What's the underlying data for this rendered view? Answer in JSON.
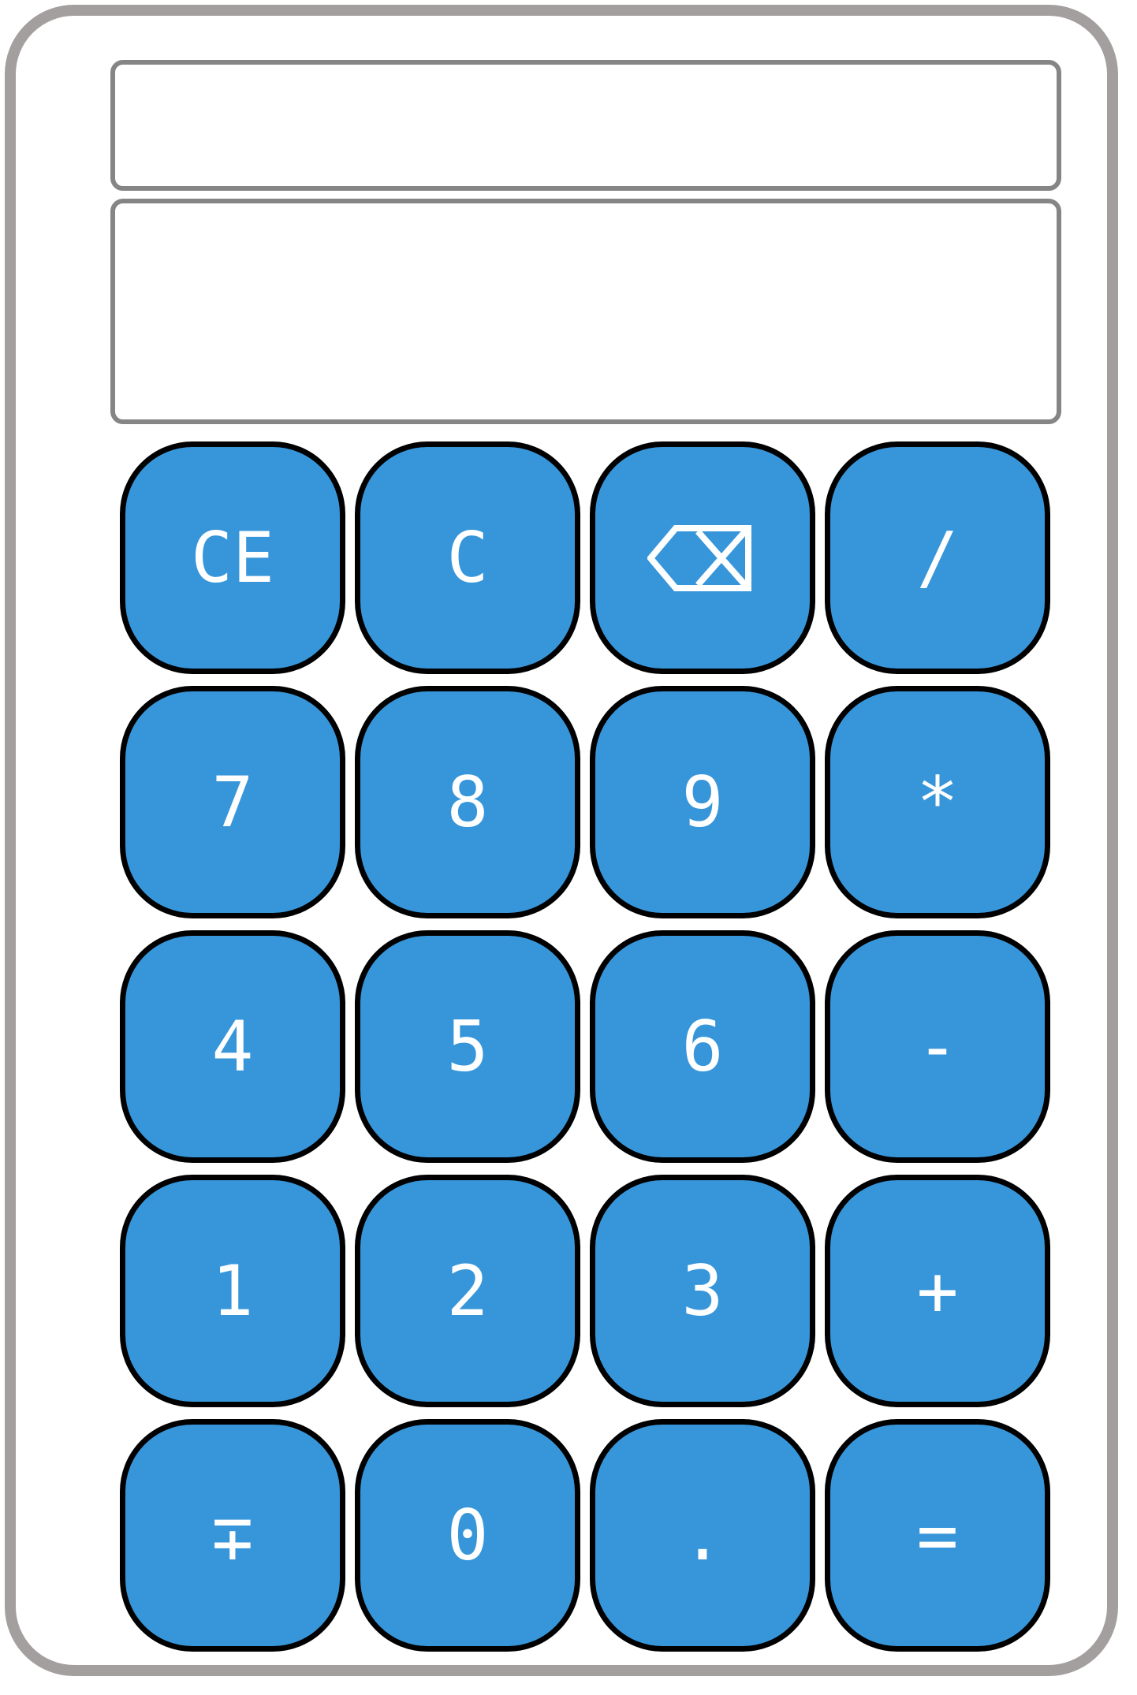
{
  "display": {
    "history": "",
    "value": ""
  },
  "keypad": {
    "rows": [
      [
        {
          "name": "clear-entry-button",
          "label": "CE"
        },
        {
          "name": "clear-button",
          "label": "C"
        },
        {
          "name": "backspace-button",
          "label": "",
          "icon": "backspace-icon"
        },
        {
          "name": "divide-button",
          "label": "/"
        }
      ],
      [
        {
          "name": "digit-7-button",
          "label": "7"
        },
        {
          "name": "digit-8-button",
          "label": "8"
        },
        {
          "name": "digit-9-button",
          "label": "9"
        },
        {
          "name": "multiply-button",
          "label": "*"
        }
      ],
      [
        {
          "name": "digit-4-button",
          "label": "4"
        },
        {
          "name": "digit-5-button",
          "label": "5"
        },
        {
          "name": "digit-6-button",
          "label": "6"
        },
        {
          "name": "subtract-button",
          "label": "-"
        }
      ],
      [
        {
          "name": "digit-1-button",
          "label": "1"
        },
        {
          "name": "digit-2-button",
          "label": "2"
        },
        {
          "name": "digit-3-button",
          "label": "3"
        },
        {
          "name": "add-button",
          "label": "+"
        }
      ],
      [
        {
          "name": "negate-button",
          "label": "∓"
        },
        {
          "name": "digit-0-button",
          "label": "0"
        },
        {
          "name": "decimal-button",
          "label": "."
        },
        {
          "name": "equals-button",
          "label": "="
        }
      ]
    ]
  },
  "colors": {
    "key_fill": "#3796da",
    "key_border": "#000000",
    "key_text": "#ffffff",
    "frame": "#a49f9f",
    "display_border": "#858585"
  }
}
